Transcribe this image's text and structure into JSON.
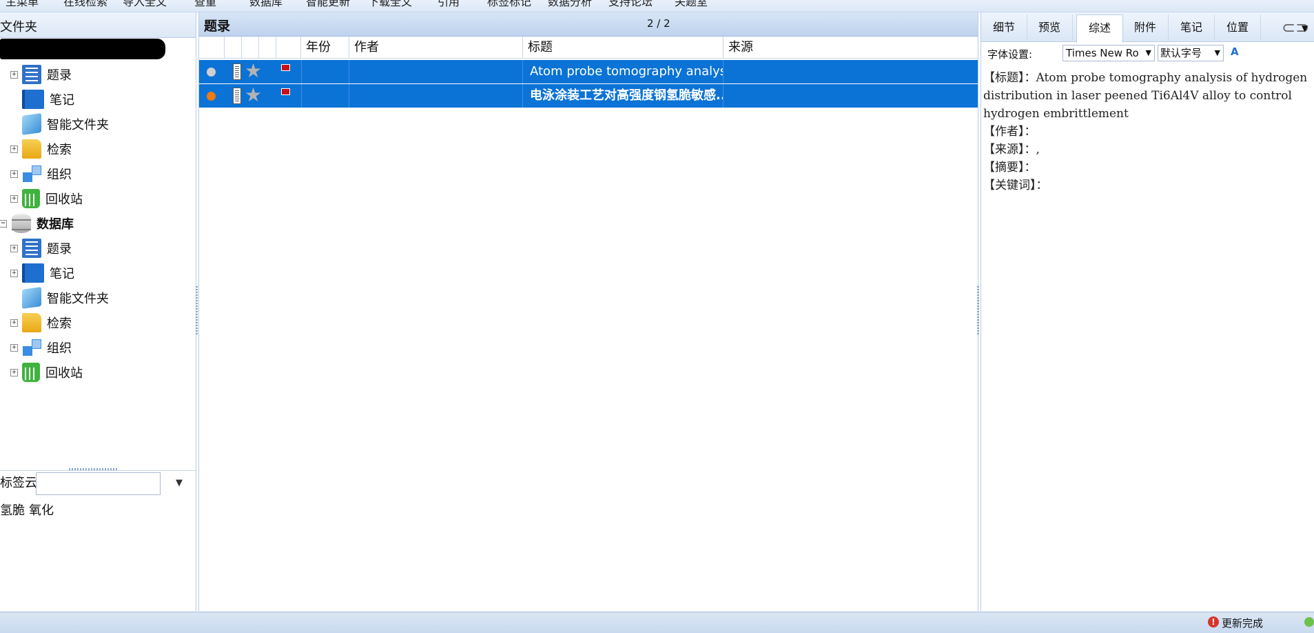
{
  "menu": {
    "items": [
      "主菜单",
      "在线检索",
      "导入全文",
      "查重",
      "数据库",
      "智能更新",
      "下载全文",
      "引用",
      "标签标记",
      "数据分析",
      "支持论坛",
      "关题室"
    ]
  },
  "left": {
    "header": "文件夹",
    "tree1": [
      "题录",
      "笔记",
      "智能文件夹",
      "检索",
      "组织",
      "回收站"
    ],
    "db_label": "数据库",
    "tree2": [
      "题录",
      "笔记",
      "智能文件夹",
      "检索",
      "组织",
      "回收站"
    ],
    "tag_cloud_label": "标签云",
    "tags": [
      "氢脆",
      "氧化"
    ]
  },
  "list": {
    "title": "题录",
    "count": "2 / 2",
    "columns": {
      "year": "年份",
      "author": "作者",
      "title": "标题",
      "source": "来源"
    },
    "rows": [
      {
        "title": "Atom probe tomography analys...",
        "dot_color": "#cfcfcf",
        "bold": false
      },
      {
        "title": "电泳涂装工艺对高强度钢氢脆敏感...",
        "dot_color": "#f07b12",
        "bold": true
      }
    ]
  },
  "right": {
    "tabs": [
      "细节",
      "预览",
      "综述",
      "附件",
      "笔记",
      "位置"
    ],
    "active_tab": "综述",
    "font_label": "字体设置:",
    "font_name": "Times New Ro",
    "font_size": "默认字号",
    "summary": {
      "title_line": "【标题】：Atom probe tomography analysis of hydrogen distribution in laser peened Ti6Al4V alloy to control hydrogen embrittlement",
      "author_line": "【作者】：",
      "source_line": "【来源】：,",
      "abstract_line": "【摘要】：",
      "keywords_line": "【关键词】："
    }
  },
  "status": {
    "text": "更新完成"
  },
  "colors": {
    "selection": "#0b73d6",
    "panel_header": "#dbe7f6"
  }
}
